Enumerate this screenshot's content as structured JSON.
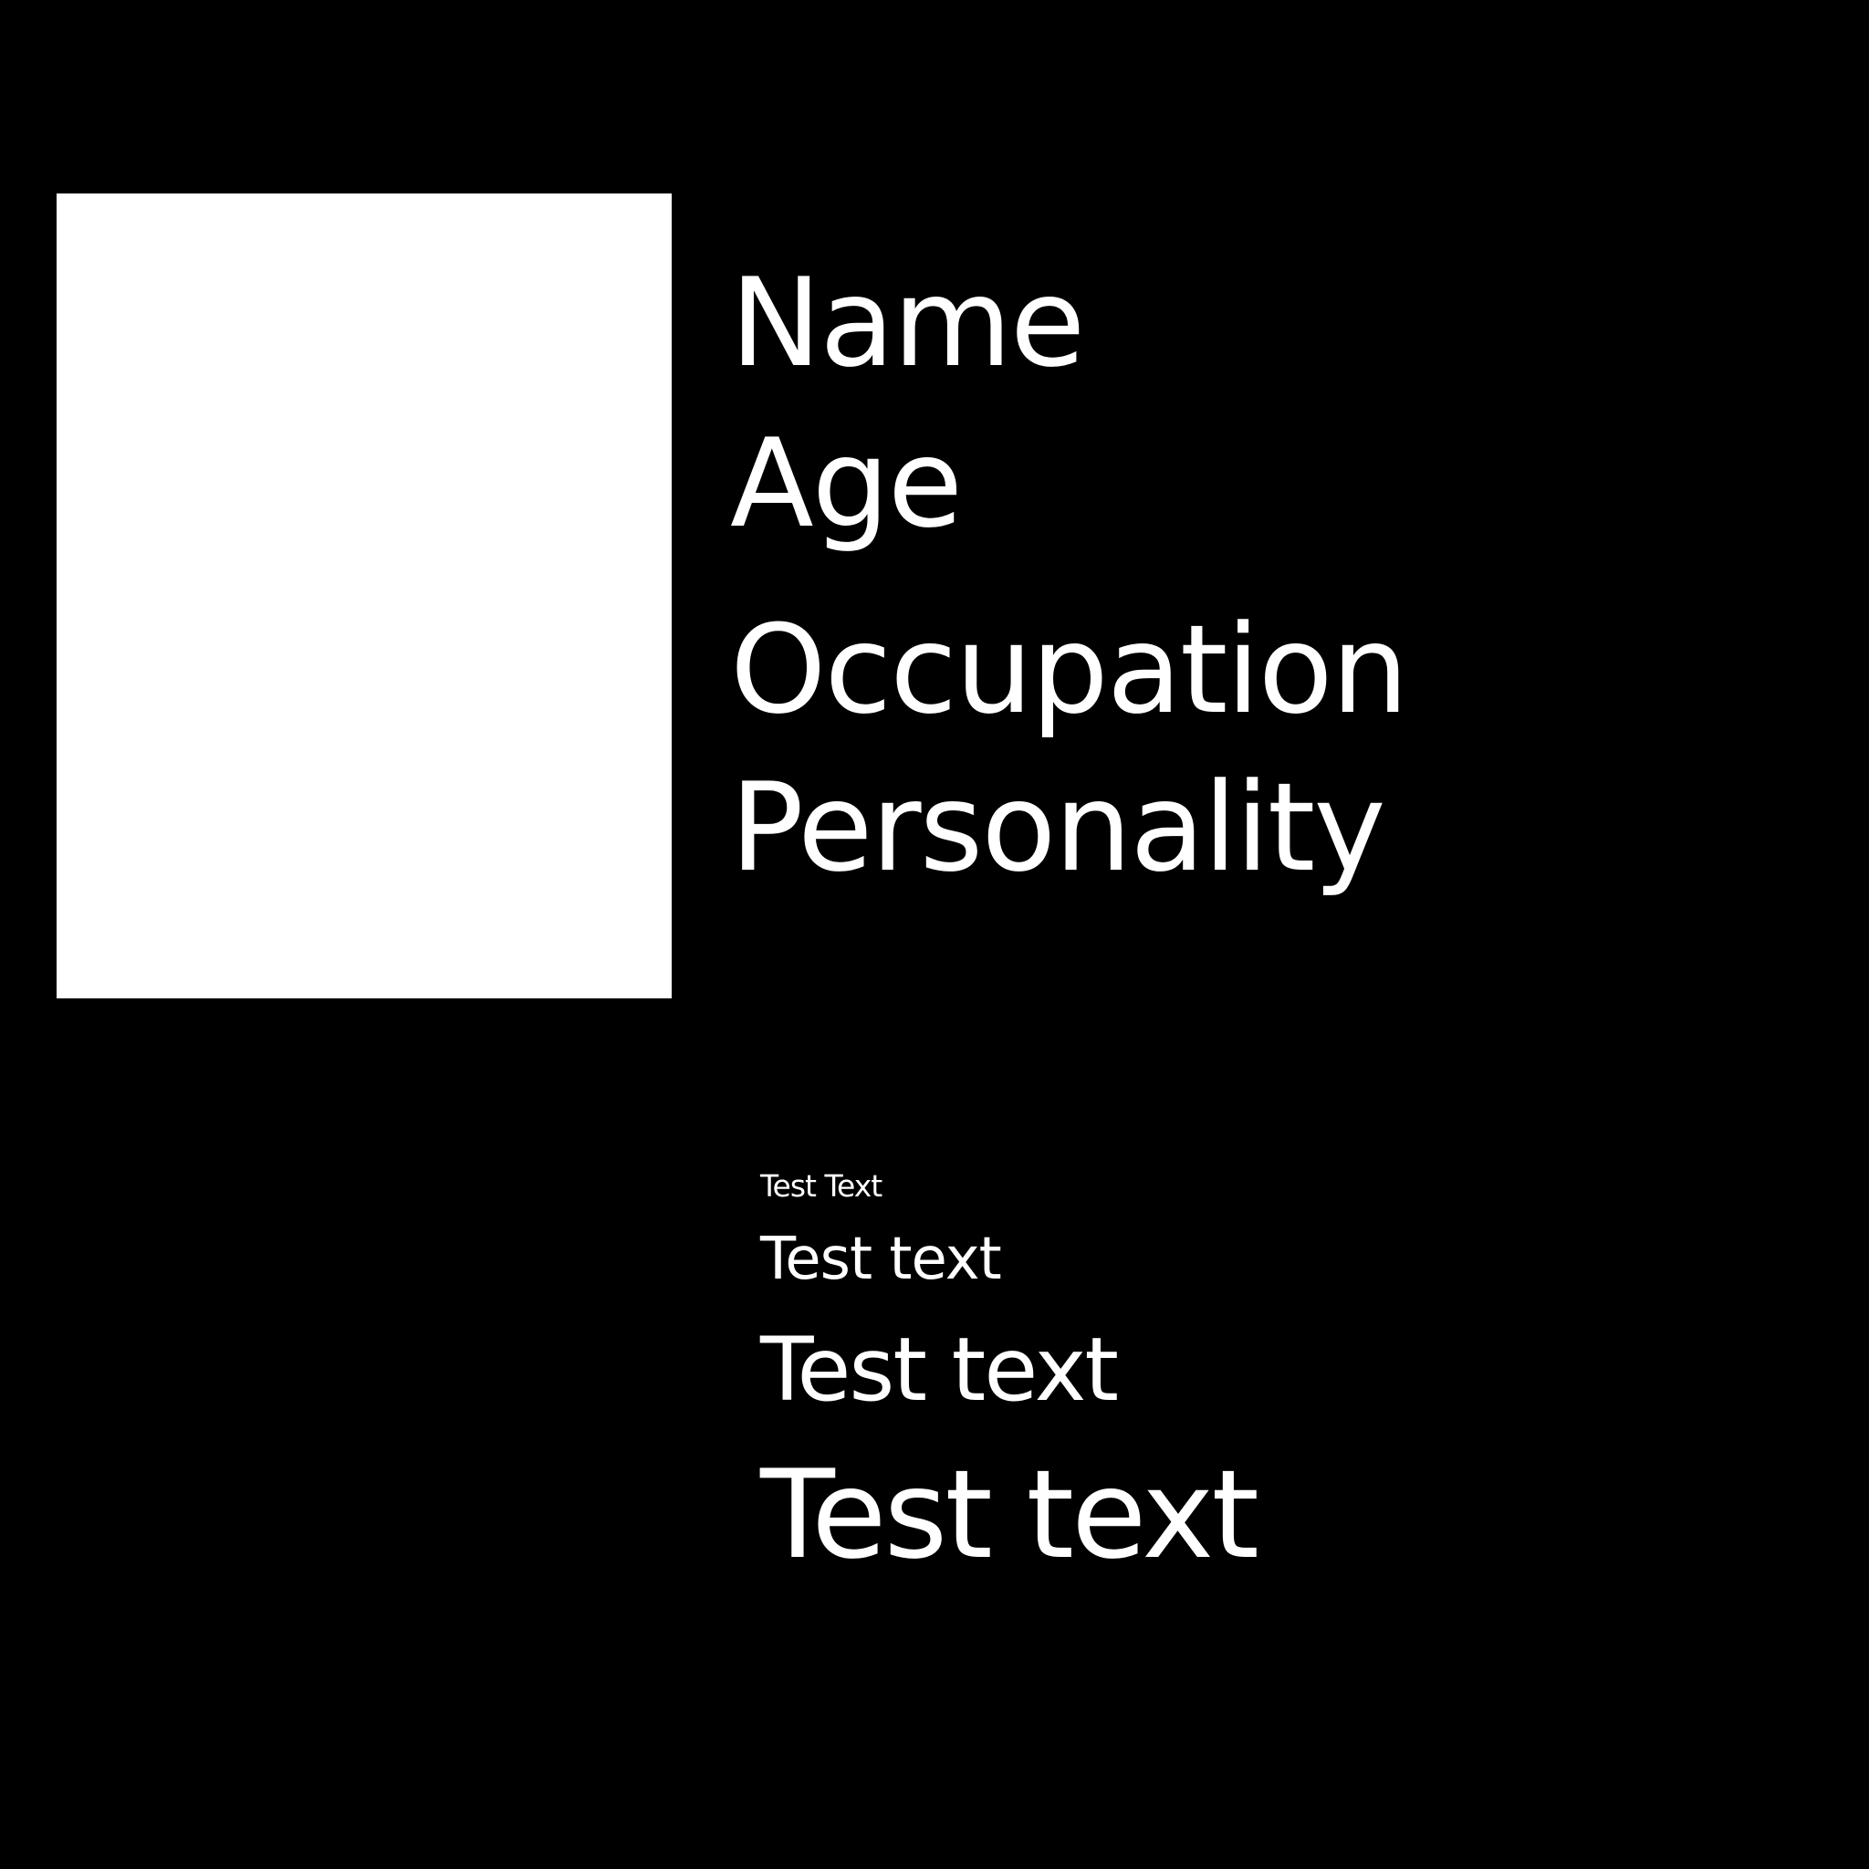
{
  "profile": {
    "fields": {
      "name": "Name",
      "age": "Age",
      "occupation": "Occupation",
      "personality": "Personality"
    }
  },
  "samples": {
    "line1": "Test Text",
    "line2": "Test text",
    "line3": "Test text",
    "line4": "Test text"
  },
  "colors": {
    "background": "#000000",
    "foreground": "#ffffff",
    "photo_placeholder": "#ffffff"
  }
}
